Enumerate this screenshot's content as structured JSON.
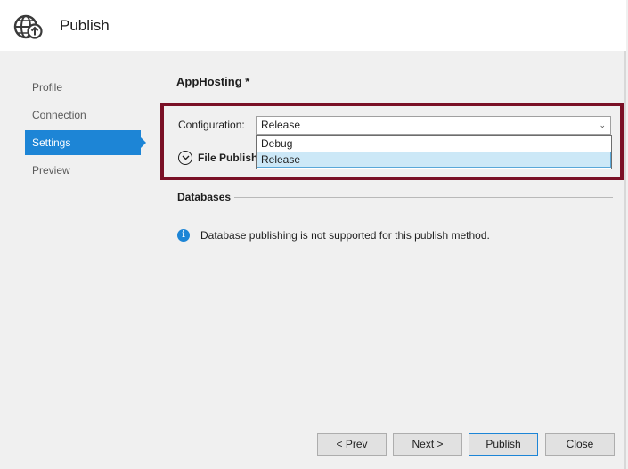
{
  "header": {
    "title": "Publish",
    "icon": "globe-publish-icon"
  },
  "sidebar": {
    "items": [
      {
        "label": "Profile",
        "active": false
      },
      {
        "label": "Connection",
        "active": false
      },
      {
        "label": "Settings",
        "active": true
      },
      {
        "label": "Preview",
        "active": false
      }
    ]
  },
  "main": {
    "profile_name": "AppHosting *",
    "configuration": {
      "label": "Configuration:",
      "value": "Release",
      "options": [
        "Debug",
        "Release"
      ],
      "selected_option": "Release"
    },
    "file_publish_label": "File Publish",
    "databases": {
      "title": "Databases",
      "info_text": "Database publishing is not supported for this publish method."
    }
  },
  "footer": {
    "prev_label": "< Prev",
    "next_label": "Next >",
    "publish_label": "Publish",
    "close_label": "Close"
  },
  "colors": {
    "accent": "#1d85d6",
    "highlight_border": "#7a1026",
    "selected_option_bg": "#cce8f7"
  }
}
